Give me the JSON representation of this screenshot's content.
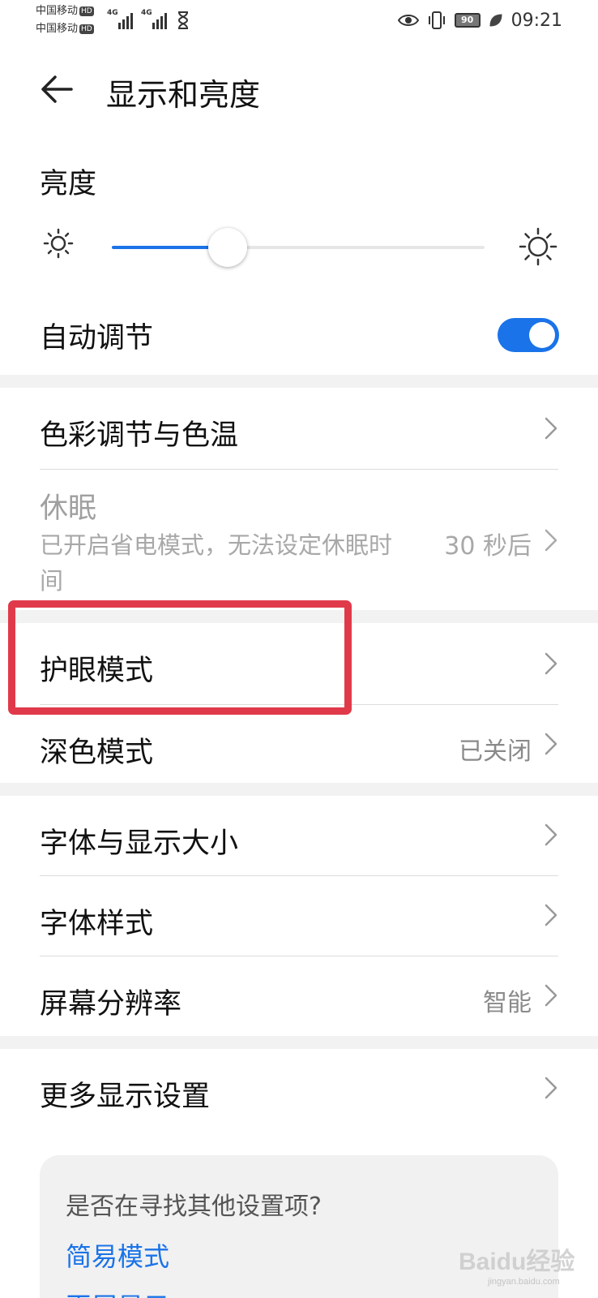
{
  "status_bar": {
    "carrier1": "中国移动",
    "carrier2": "中国移动",
    "hd_badge": "HD",
    "network1": "4G",
    "network2": "4G",
    "battery": "90",
    "time": "09:21"
  },
  "header": {
    "title": "显示和亮度"
  },
  "brightness": {
    "label": "亮度",
    "level": 0.31,
    "auto_label": "自动调节",
    "auto_enabled": true
  },
  "rows": {
    "color": {
      "label": "色彩调节与色温"
    },
    "sleep": {
      "label": "休眠",
      "description": "已开启省电模式，无法设定休眠时间",
      "value": "30 秒后"
    },
    "eye_comfort": {
      "label": "护眼模式"
    },
    "dark_mode": {
      "label": "深色模式",
      "value": "已关闭"
    },
    "font_size": {
      "label": "字体与显示大小"
    },
    "font_style": {
      "label": "字体样式"
    },
    "resolution": {
      "label": "屏幕分辨率",
      "value": "智能"
    },
    "more": {
      "label": "更多显示设置"
    }
  },
  "suggestions": {
    "title": "是否在寻找其他设置项?",
    "links": [
      "简易模式",
      "灭屏显示"
    ]
  },
  "watermark": {
    "brand": "Baidu经验",
    "url": "jingyan.baidu.com"
  },
  "colors": {
    "accent": "#1a73e8",
    "highlight": "#e03a4a",
    "section_gap": "#f2f2f2"
  }
}
